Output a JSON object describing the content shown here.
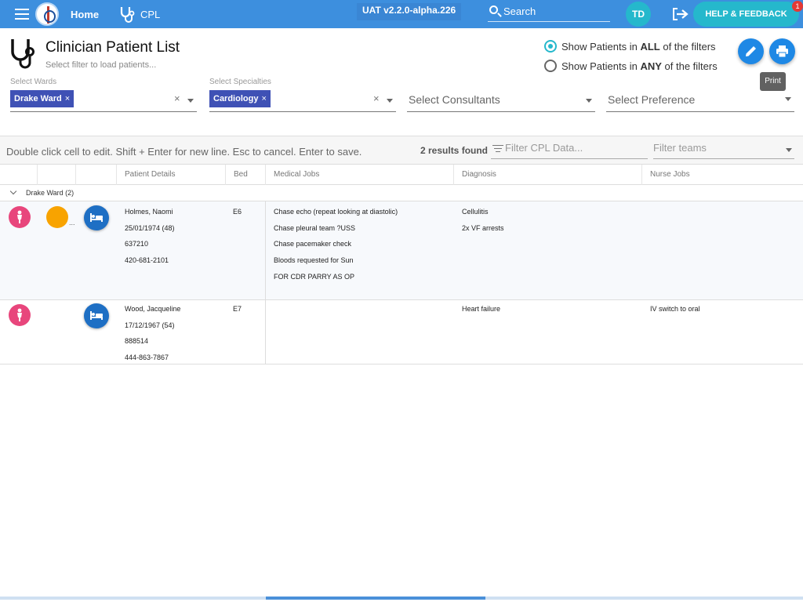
{
  "topbar": {
    "home_label": "Home",
    "app_label": "CPL",
    "version": "UAT v2.2.0-alpha.226",
    "search_placeholder": "Search",
    "user_initials": "TD",
    "help_label": "HELP & FEEDBACK",
    "help_badge": "1"
  },
  "page": {
    "title": "Clinician Patient List",
    "subtitle": "Select filter to load patients..."
  },
  "filter_mode": {
    "options": [
      {
        "prefix": "Show Patients in ",
        "bold": "ALL",
        "suffix": " of the filters",
        "selected": true
      },
      {
        "prefix": "Show Patients in ",
        "bold": "ANY",
        "suffix": " of the filters",
        "selected": false
      }
    ]
  },
  "actions": {
    "print_tooltip": "Print"
  },
  "filters": {
    "wards_label": "Select Wards",
    "wards_chip": "Drake Ward",
    "specialties_label": "Select Specialties",
    "specialties_chip": "Cardiology",
    "chip_remove": "×",
    "clear": "×",
    "consultants_placeholder": "Select Consultants",
    "preference_placeholder": "Select Preference"
  },
  "toolbar": {
    "hint": "Double click cell to edit. Shift + Enter for new line. Esc to cancel. Enter to save.",
    "results": "2 results found",
    "filter_placeholder": "Filter CPL Data...",
    "teams_placeholder": "Filter teams"
  },
  "grid": {
    "columns": [
      "Patient Details",
      "Bed",
      "Medical Jobs",
      "Diagnosis",
      "Nurse Jobs"
    ],
    "group_label": "Drake Ward (2)",
    "rows": [
      {
        "details": [
          "Holmes, Naomi",
          "25/01/1974 (48)",
          "637210",
          "420-681-2101"
        ],
        "bed": "E6",
        "medical_jobs": [
          "Chase echo (repeat looking at diastolic)",
          "Chase pleural team ?USS",
          "Chase pacemaker check",
          "Bloods requested for Sun",
          "FOR CDR PARRY AS OP"
        ],
        "diagnosis": [
          "Cellulitis",
          "2x VF arrests"
        ],
        "nurse_jobs": [],
        "ellipsis": "..."
      },
      {
        "details": [
          "Wood, Jacqueline",
          "17/12/1967 (54)",
          "888514",
          "444-863-7867"
        ],
        "bed": "E7",
        "medical_jobs": [],
        "diagnosis": [
          "Heart failure"
        ],
        "nurse_jobs": [
          "IV switch to oral"
        ]
      }
    ]
  },
  "colors": {
    "topbar": "#3d8fde",
    "accent": "#25b8cc",
    "chip": "#3f51b5",
    "female": "#e8467c",
    "alert": "#f8a300",
    "fab": "#1e88e5"
  }
}
